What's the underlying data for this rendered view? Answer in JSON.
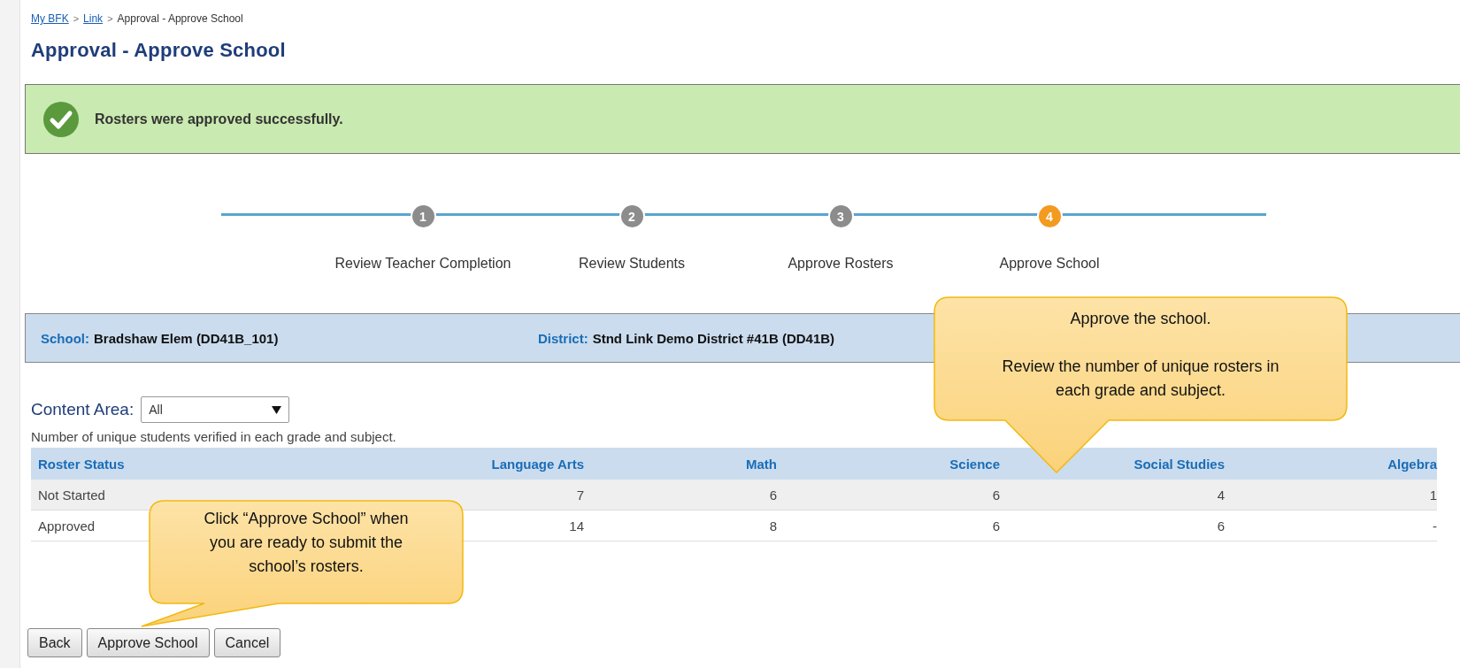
{
  "breadcrumb": [
    {
      "label": "My BFK",
      "kind": "link"
    },
    {
      "label": "Link",
      "kind": "link"
    },
    {
      "label": "Approval - Approve School",
      "kind": "current"
    }
  ],
  "breadcrumb_separator": ">",
  "title": "Approval - Approve School",
  "alert": {
    "message": "Rosters were approved successfully."
  },
  "steps": [
    {
      "number": "1",
      "label": "Review Teacher Completion",
      "selected": false
    },
    {
      "number": "2",
      "label": "Review Students",
      "selected": false
    },
    {
      "number": "3",
      "label": "Approve Rosters",
      "selected": false
    },
    {
      "number": "4",
      "label": "Approve School",
      "selected": true
    }
  ],
  "info_bar": [
    {
      "label": "School:",
      "value": "Bradshaw Elem (DD41B_101)"
    },
    {
      "label": "District:",
      "value": "Stnd Link Demo District #41B (DD41B)"
    }
  ],
  "content_area": {
    "label": "Content Area:",
    "value": "All"
  },
  "table": {
    "caption": "Number of unique students verified in each grade and subject.",
    "columns": [
      "Roster Status",
      "Language Arts",
      "Math",
      "Science",
      "Social Studies",
      "Algebra"
    ],
    "rows": [
      [
        "Not Started",
        "7",
        "6",
        "6",
        "4",
        "1"
      ],
      [
        "Approved",
        "14",
        "8",
        "6",
        "6",
        "-"
      ]
    ]
  },
  "buttons": [
    "Back",
    "Approve School",
    "Cancel"
  ],
  "callouts": [
    {
      "paragraphs": [
        "Approve the school.",
        "Review the number of unique rosters in each grade and subject."
      ]
    },
    {
      "paragraphs": [
        "Click “Approve School” when you are ready to submit the school’s rosters."
      ]
    }
  ]
}
